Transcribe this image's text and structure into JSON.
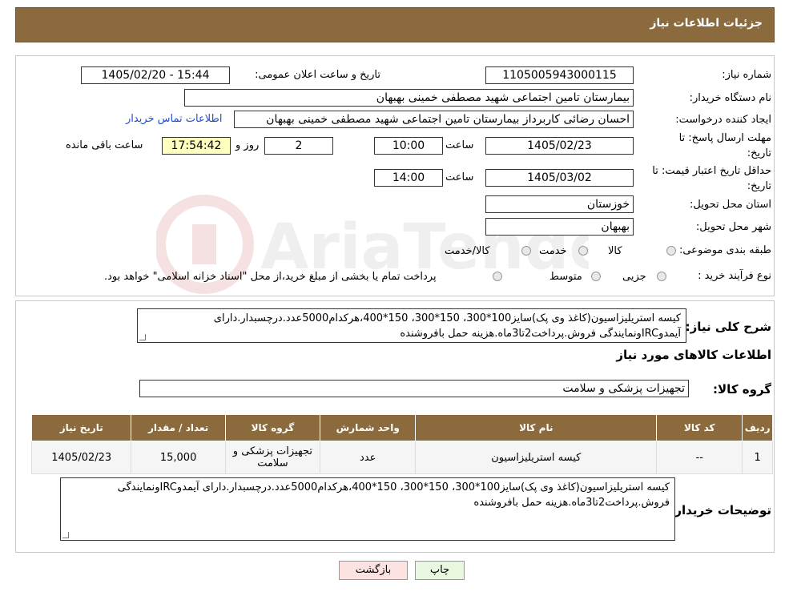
{
  "header": {
    "title": "جزئیات اطلاعات نیاز"
  },
  "fields": {
    "need_number_label": "شماره نیاز:",
    "need_number": "1105005943000115",
    "announce_label": "تاریخ و ساعت اعلان عمومی:",
    "announce_value": "1405/02/20 - 15:44",
    "buyer_org_label": "نام دستگاه خریدار:",
    "buyer_org": "بیمارستان تامین اجتماعی شهید مصطفی خمینی بهبهان",
    "creator_label": "ایجاد کننده درخواست:",
    "creator": "احسان رضائی کاربرداز بیمارستان تامین اجتماعی شهید مصطفی خمینی بهبهان",
    "contact_link": "اطلاعات تماس خریدار",
    "deadline_label_1": "مهلت ارسال پاسخ: تا",
    "deadline_label_2": "تاریخ:",
    "deadline_date": "1405/02/23",
    "time_label": "ساعت",
    "deadline_time": "10:00",
    "days_value": "2",
    "days_label": "روز و",
    "remaining_time": "17:54:42",
    "remaining_label": "ساعت باقی مانده",
    "validity_label_1": "حداقل تاریخ اعتبار قیمت: تا",
    "validity_label_2": "تاریخ:",
    "validity_date": "1405/03/02",
    "validity_time": "14:00",
    "province_label": "استان محل تحویل:",
    "province": "خوزستان",
    "city_label": "شهر محل تحویل:",
    "city": "بهبهان",
    "category_label": "طبقه بندی موضوعی:",
    "category_options": [
      "کالا",
      "خدمت",
      "کالا/خدمت"
    ],
    "process_label": "نوع فرآیند خرید :",
    "process_options": [
      "جزیی",
      "متوسط"
    ],
    "process_note": "پرداخت تمام یا بخشی از مبلغ خرید،از محل \"اسناد خزانه اسلامی\" خواهد بود."
  },
  "description": {
    "label": "شرح کلی نیاز:",
    "text": "کیسه استریلیزاسیون(کاغذ وی پک)سایز100*300، 150*300، 150*400،هرکدام5000عدد.درچسبدار.دارای آیمدوIRCونمایندگی فروش.پرداخت2تا3ماه.هزینه حمل بافروشنده"
  },
  "goods_section": {
    "title": "اطلاعات کالاهای مورد نیاز",
    "group_label": "گروه کالا:",
    "group_value": "تجهیزات پزشکی و سلامت"
  },
  "table": {
    "headers": [
      "ردیف",
      "کد کالا",
      "نام کالا",
      "واحد شمارش",
      "گروه کالا",
      "تعداد / مقدار",
      "تاریخ نیاز"
    ],
    "rows": [
      [
        "1",
        "--",
        "کیسه استریلیزاسیون",
        "عدد",
        "تجهیزات پزشکی و سلامت",
        "15,000",
        "1405/02/23"
      ]
    ]
  },
  "buyer_notes": {
    "label": "توضیحات خریدار:",
    "text": "کیسه استریلیزاسیون(کاغذ وی پک)سایز100*300، 150*300، 150*400،هرکدام5000عدد.درچسبدار.دارای آیمدوIRCونمایندگی فروش.پرداخت2تا3ماه.هزینه حمل بافروشنده"
  },
  "buttons": {
    "print": "چاپ",
    "back": "بازگشت"
  },
  "colors": {
    "header_bg": "#8b6b3d",
    "link": "#1a4fd6",
    "remaining_bg": "#ffffc0"
  }
}
